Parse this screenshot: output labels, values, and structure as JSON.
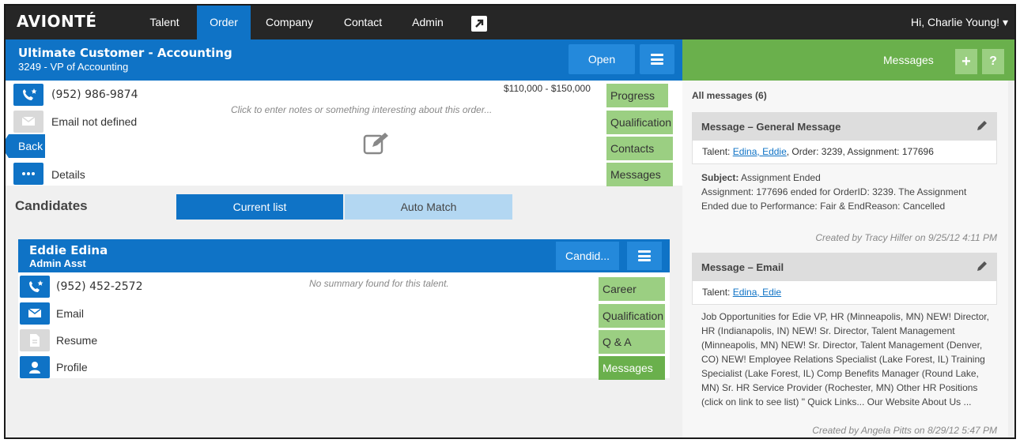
{
  "nav": {
    "logo": "AVIONTÉ",
    "items": [
      {
        "label": "Talent",
        "active": false
      },
      {
        "label": "Order",
        "active": true
      },
      {
        "label": "Company",
        "active": false
      },
      {
        "label": "Contact",
        "active": false
      },
      {
        "label": "Admin",
        "active": false
      }
    ],
    "external_icon": "external-link-icon",
    "greeting": "Hi, Charlie Young! ▾"
  },
  "order": {
    "title": "Ultimate Customer - Accounting",
    "subtitle": "3249 - VP of Accounting",
    "open_label": "Open",
    "phone": "(952) 986-9874",
    "email": "Email not defined",
    "back_label": "Back",
    "details_label": "Details",
    "salary": "$110,000 - $150,000",
    "notes_placeholder": "Click to enter notes or something interesting about this order...",
    "tabs": [
      "Progress",
      "Qualification",
      "Contacts",
      "Messages"
    ]
  },
  "candidates": {
    "label": "Candidates",
    "current_list": "Current list",
    "auto_match": "Auto Match",
    "card": {
      "name": "Eddie Edina",
      "subtitle": "Admin Asst",
      "candid_label": "Candid...",
      "phone": "(952) 452-2572",
      "email": "Email",
      "resume": "Resume",
      "profile": "Profile",
      "summary": "No summary found for this talent.",
      "tabs": [
        "Career",
        "Qualification",
        "Q & A",
        "Messages"
      ]
    }
  },
  "messages": {
    "title": "Messages",
    "count_label": "All messages (6)",
    "list": [
      {
        "title": "Message – General Message",
        "tag_prefix": "Talent: ",
        "tag_link": "Edina, Eddie",
        "tag_suffix": ", Order: 3239, Assignment: 177696",
        "subject_label": "Subject:",
        "subject": " Assignment Ended",
        "body": "Assignment: 177696 ended for OrderID: 3239. The Assignment Ended due to Performance: Fair & EndReason: Cancelled",
        "meta": "Created by Tracy Hilfer on 9/25/12 4:11 PM"
      },
      {
        "title": "Message – Email",
        "tag_prefix": "Talent: ",
        "tag_link": "Edina, Edie",
        "body": "Job Opportunities for Edie VP, HR (Minneapolis, MN) NEW! Director, HR (Indianapolis, IN) NEW! Sr. Director, Talent Management (Minneapolis, MN) NEW! Sr. Director, Talent Management (Denver, CO) NEW! Employee Relations Specialist (Lake Forest, IL) Training Specialist (Lake Forest, IL) Comp Benefits Manager (Round Lake, MN) Sr. HR Service Provider (Rochester, MN) Other HR Positions (click on link to see list) \" Quick Links... Our Website About Us ...",
        "meta": "Created by Angela Pitts on 8/29/12 5:47 PM"
      }
    ]
  },
  "colors": {
    "primary": "#0f73c6",
    "green": "#6ab04c",
    "light_green": "#9bcf82",
    "nav": "#262626"
  }
}
